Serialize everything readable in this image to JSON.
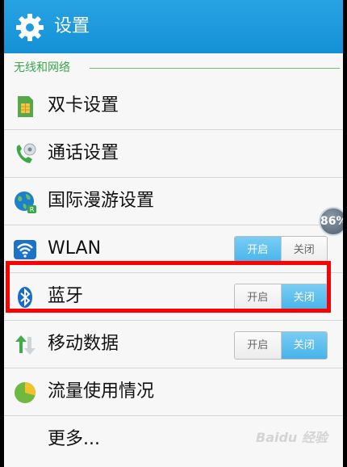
{
  "header": {
    "title": "设置",
    "icon": "gear-icon"
  },
  "section": {
    "label": "无线和网络"
  },
  "rows": [
    {
      "label": "双卡设置",
      "icon": "sim-card-icon"
    },
    {
      "label": "通话设置",
      "icon": "phone-icon"
    },
    {
      "label": "国际漫游设置",
      "icon": "globe-roaming-icon"
    },
    {
      "label": "WLAN",
      "icon": "wifi-icon",
      "toggle": {
        "on_label": "开启",
        "off_label": "关闭",
        "state": "on"
      }
    },
    {
      "label": "蓝牙",
      "icon": "bluetooth-icon",
      "toggle": {
        "on_label": "开启",
        "off_label": "关闭",
        "state": "off"
      }
    },
    {
      "label": "移动数据",
      "icon": "mobile-data-arrows-icon",
      "toggle": {
        "on_label": "开启",
        "off_label": "关闭",
        "state": "off"
      }
    },
    {
      "label": "流量使用情况",
      "icon": "pie-chart-icon"
    },
    {
      "label": "更多..."
    }
  ],
  "badge": {
    "text": "86%"
  },
  "watermark": {
    "text": "Baidu 经验"
  }
}
